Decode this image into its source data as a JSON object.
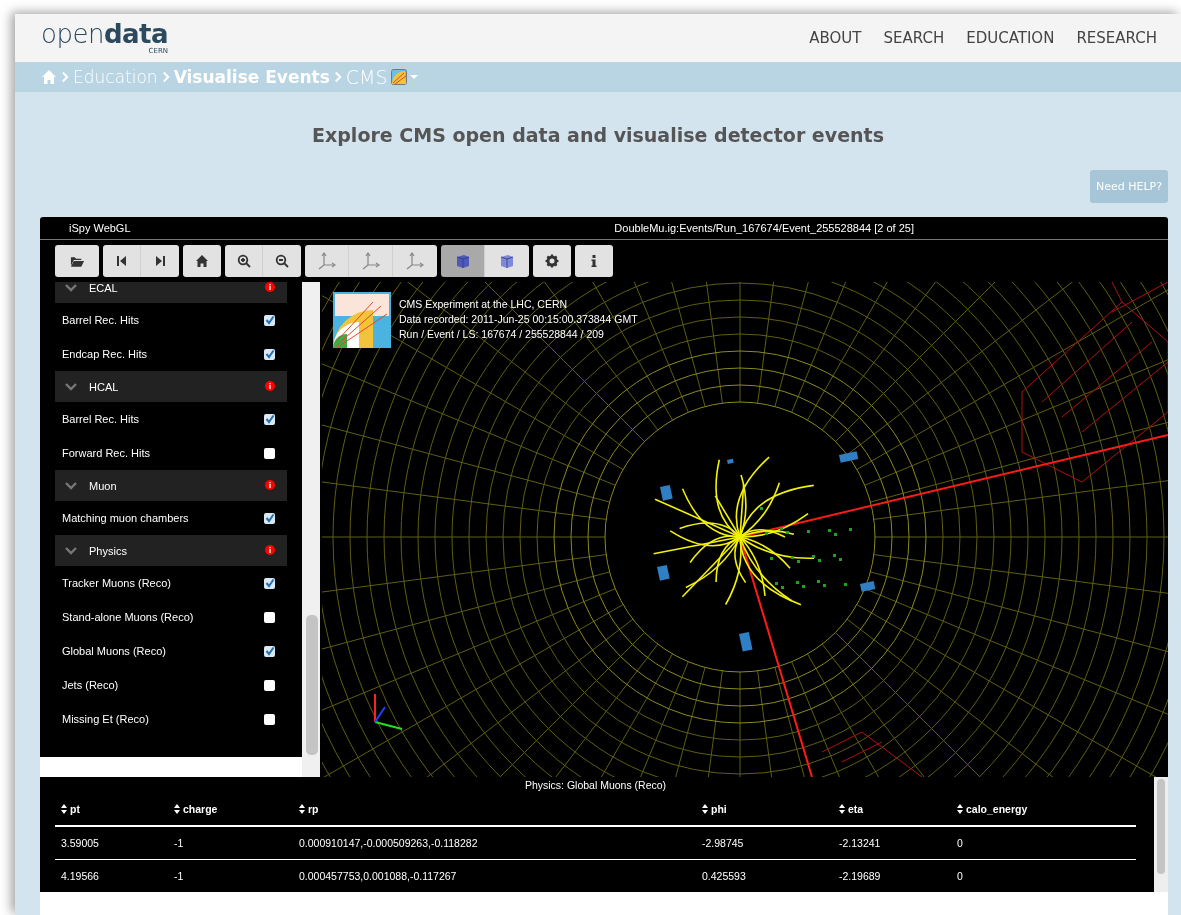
{
  "header": {
    "logo": "open**data**",
    "logo_sub": "CERN",
    "nav": [
      "ABOUT",
      "SEARCH",
      "EDUCATION",
      "RESEARCH"
    ]
  },
  "breadcrumb": [
    {
      "label": "Education",
      "kind": "link"
    },
    {
      "label": "Visualise Events",
      "kind": "strong"
    },
    {
      "label": "CMS",
      "kind": "dropdown"
    }
  ],
  "page_title": "Explore CMS open data and visualise detector events",
  "help_button": "Need HELP?",
  "viewer": {
    "app_name": "iSpy WebGL",
    "event_path": "DoubleMu.ig:Events/Run_167674/Event_255528844 [2 of 25]",
    "view_modes": [
      {
        "selected": true
      },
      {
        "selected": false
      }
    ],
    "tree": [
      {
        "name": "ECAL",
        "children": [
          {
            "name": "Barrel Rec. Hits",
            "checked": true
          },
          {
            "name": "Endcap Rec. Hits",
            "checked": true
          }
        ]
      },
      {
        "name": "HCAL",
        "children": [
          {
            "name": "Barrel Rec. Hits",
            "checked": true
          },
          {
            "name": "Forward Rec. Hits",
            "checked": false
          }
        ]
      },
      {
        "name": "Muon",
        "children": [
          {
            "name": "Matching muon chambers",
            "checked": true
          }
        ]
      },
      {
        "name": "Physics",
        "children": [
          {
            "name": "Tracker Muons (Reco)",
            "checked": true
          },
          {
            "name": "Stand-alone Muons (Reco)",
            "checked": false
          },
          {
            "name": "Global Muons (Reco)",
            "checked": true
          },
          {
            "name": "Jets (Reco)",
            "checked": false
          },
          {
            "name": "Missing Et (Reco)",
            "checked": false
          }
        ]
      }
    ],
    "event_info": [
      "CMS Experiment at the LHC, CERN",
      "Data recorded: 2011-Jun-25 00:15:00.373844 GMT",
      "Run / Event / LS: 167674 / 255528844 / 209"
    ],
    "table": {
      "caption": "Physics: Global Muons (Reco)",
      "columns": [
        "pt",
        "charge",
        "rp",
        "phi",
        "eta",
        "calo_energy"
      ],
      "rows": [
        [
          "3.59005",
          "-1",
          "0.000910147,-0.000509263,-0.118282",
          "-2.98745",
          "-2.13241",
          "0"
        ],
        [
          "4.19566",
          "-1",
          "0.000457753,0.001088,-0.117267",
          "0.425593",
          "-2.19689",
          "0"
        ]
      ]
    }
  }
}
